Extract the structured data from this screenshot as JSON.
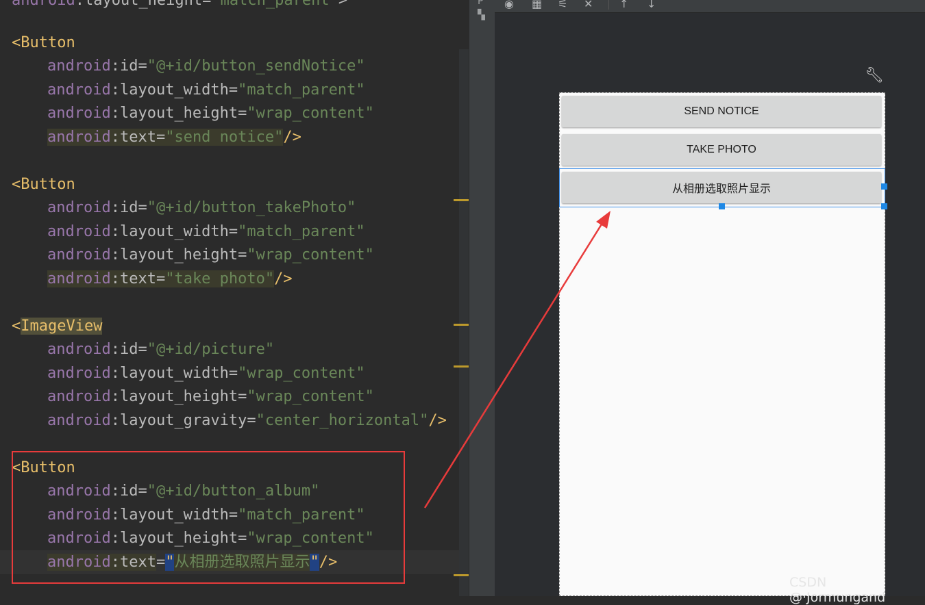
{
  "editor": {
    "lines": [
      {
        "id": "l0",
        "parts": [
          [
            "attr-ns",
            "android"
          ],
          [
            "op",
            ":"
          ],
          [
            "attr-name",
            "layout_height"
          ],
          [
            "op",
            "="
          ],
          [
            "val",
            "\"match_parent\""
          ],
          [
            "op",
            ">"
          ]
        ]
      },
      {
        "id": "l1",
        "parts": [
          [
            "tag-bracket",
            "<"
          ],
          [
            "tag-name",
            "Button"
          ]
        ]
      },
      {
        "id": "l2",
        "parts": [
          [
            "attr-ns",
            "android"
          ],
          [
            "op",
            ":"
          ],
          [
            "attr-name",
            "id"
          ],
          [
            "op",
            "="
          ],
          [
            "val",
            "\"@+id/button_sendNotice\""
          ]
        ]
      },
      {
        "id": "l3",
        "parts": [
          [
            "attr-ns",
            "android"
          ],
          [
            "op",
            ":"
          ],
          [
            "attr-name",
            "layout_width"
          ],
          [
            "op",
            "="
          ],
          [
            "val",
            "\"match_parent\""
          ]
        ]
      },
      {
        "id": "l4",
        "parts": [
          [
            "attr-ns",
            "android"
          ],
          [
            "op",
            ":"
          ],
          [
            "attr-name",
            "layout_height"
          ],
          [
            "op",
            "="
          ],
          [
            "val",
            "\"wrap_content\""
          ]
        ]
      },
      {
        "id": "l5",
        "parts": [
          [
            "attr-ns hl-weak",
            "android"
          ],
          [
            "op hl-weak",
            ":"
          ],
          [
            "attr-name hl-weak",
            "text"
          ],
          [
            "op hl-weak",
            "="
          ],
          [
            "val hl-weak",
            "\"send notice\""
          ],
          [
            "tag-bracket",
            "/>"
          ]
        ]
      },
      {
        "id": "l6",
        "parts": [
          [
            "tag-bracket",
            "<"
          ],
          [
            "tag-name",
            "Button"
          ]
        ]
      },
      {
        "id": "l7",
        "parts": [
          [
            "attr-ns",
            "android"
          ],
          [
            "op",
            ":"
          ],
          [
            "attr-name",
            "id"
          ],
          [
            "op",
            "="
          ],
          [
            "val",
            "\"@+id/button_takePhoto\""
          ]
        ]
      },
      {
        "id": "l8",
        "parts": [
          [
            "attr-ns",
            "android"
          ],
          [
            "op",
            ":"
          ],
          [
            "attr-name",
            "layout_width"
          ],
          [
            "op",
            "="
          ],
          [
            "val",
            "\"match_parent\""
          ]
        ]
      },
      {
        "id": "l9",
        "parts": [
          [
            "attr-ns",
            "android"
          ],
          [
            "op",
            ":"
          ],
          [
            "attr-name",
            "layout_height"
          ],
          [
            "op",
            "="
          ],
          [
            "val",
            "\"wrap_content\""
          ]
        ]
      },
      {
        "id": "l10",
        "parts": [
          [
            "attr-ns hl-weak",
            "android"
          ],
          [
            "op hl-weak",
            ":"
          ],
          [
            "attr-name hl-weak",
            "text"
          ],
          [
            "op hl-weak",
            "="
          ],
          [
            "val hl-weak",
            "\"take photo\""
          ],
          [
            "tag-bracket",
            "/>"
          ]
        ]
      },
      {
        "id": "l11",
        "parts": [
          [
            "tag-bracket",
            "<"
          ],
          [
            "tag-name hl-tag",
            "ImageView"
          ]
        ]
      },
      {
        "id": "l12",
        "parts": [
          [
            "attr-ns",
            "android"
          ],
          [
            "op",
            ":"
          ],
          [
            "attr-name",
            "id"
          ],
          [
            "op",
            "="
          ],
          [
            "val",
            "\"@+id/picture\""
          ]
        ]
      },
      {
        "id": "l13",
        "parts": [
          [
            "attr-ns",
            "android"
          ],
          [
            "op",
            ":"
          ],
          [
            "attr-name",
            "layout_width"
          ],
          [
            "op",
            "="
          ],
          [
            "val",
            "\"wrap_content\""
          ]
        ]
      },
      {
        "id": "l14",
        "parts": [
          [
            "attr-ns",
            "android"
          ],
          [
            "op",
            ":"
          ],
          [
            "attr-name",
            "layout_height"
          ],
          [
            "op",
            "="
          ],
          [
            "val",
            "\"wrap_content\""
          ]
        ]
      },
      {
        "id": "l15",
        "parts": [
          [
            "attr-ns",
            "android"
          ],
          [
            "op",
            ":"
          ],
          [
            "attr-name",
            "layout_gravity"
          ],
          [
            "op",
            "="
          ],
          [
            "val",
            "\"center_horizontal\""
          ],
          [
            "tag-bracket",
            "/>"
          ]
        ]
      },
      {
        "id": "l16",
        "parts": [
          [
            "tag-bracket",
            "<"
          ],
          [
            "tag-name",
            "Button"
          ]
        ]
      },
      {
        "id": "l17",
        "parts": [
          [
            "attr-ns",
            "android"
          ],
          [
            "op",
            ":"
          ],
          [
            "attr-name",
            "id"
          ],
          [
            "op",
            "="
          ],
          [
            "val",
            "\"@+id/button_album\""
          ]
        ]
      },
      {
        "id": "l18",
        "parts": [
          [
            "attr-ns",
            "android"
          ],
          [
            "op",
            ":"
          ],
          [
            "attr-name",
            "layout_width"
          ],
          [
            "op",
            "="
          ],
          [
            "val",
            "\"match_parent\""
          ]
        ]
      },
      {
        "id": "l19",
        "parts": [
          [
            "attr-ns",
            "android"
          ],
          [
            "op",
            ":"
          ],
          [
            "attr-name",
            "layout_height"
          ],
          [
            "op",
            "="
          ],
          [
            "val",
            "\"wrap_content\""
          ]
        ]
      },
      {
        "id": "l20",
        "parts": [
          [
            "attr-ns hl-weak",
            "android"
          ],
          [
            "op hl-weak",
            ":"
          ],
          [
            "attr-name hl-weak",
            "text"
          ],
          [
            "op",
            "="
          ],
          [
            "hl-quote",
            "\""
          ],
          [
            "val hl-weak",
            "从相册选取照片显示"
          ],
          [
            "hl-quote",
            "\""
          ],
          [
            "tag-bracket",
            "/>"
          ]
        ]
      }
    ]
  },
  "side_strip": {
    "panel_letter": "P"
  },
  "designer": {
    "buttons": [
      {
        "label": "SEND NOTICE"
      },
      {
        "label": "TAKE PHOTO"
      },
      {
        "label": "从相册选取照片显示"
      }
    ]
  },
  "watermark": "CSDN @·Jormungand",
  "colors": {
    "annotation_red": "#e83b3b",
    "selection_blue": "#1e88e5",
    "editor_bg": "#2b2b2b"
  }
}
